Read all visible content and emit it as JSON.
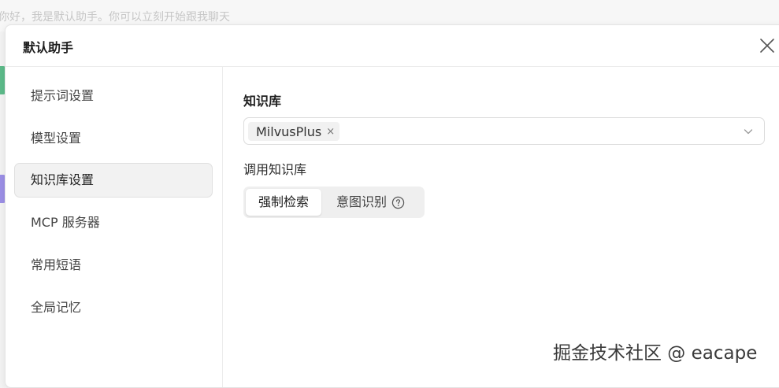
{
  "background": {
    "greeting": "你好，我是默认助手。你可以立刻开始跟我聊天",
    "accent_colors": [
      "#5dbb8a",
      "#9c8fe6"
    ]
  },
  "modal": {
    "title": "默认助手",
    "close_icon": "close-icon"
  },
  "sidebar": {
    "items": [
      {
        "label": "提示词设置",
        "active": false
      },
      {
        "label": "模型设置",
        "active": false
      },
      {
        "label": "知识库设置",
        "active": true
      },
      {
        "label": "MCP 服务器",
        "active": false
      },
      {
        "label": "常用短语",
        "active": false
      },
      {
        "label": "全局记忆",
        "active": false
      }
    ]
  },
  "knowledge_base": {
    "section_title": "知识库",
    "selected_tags": [
      "MilvusPlus"
    ],
    "tag_remove_glyph": "×",
    "dropdown_icon": "chevron-down-icon",
    "call_mode_title": "调用知识库",
    "call_modes": [
      {
        "label": "强制检索",
        "active": true
      },
      {
        "label": "意图识别",
        "active": false,
        "icon": "help-circle-icon"
      }
    ]
  },
  "watermark": "掘金技术社区 @ eacape",
  "colors": {
    "modal_bg": "#ffffff",
    "active_nav_bg": "#f2f2f2",
    "segmented_bg": "#efefef",
    "border": "#e0e0e0"
  }
}
